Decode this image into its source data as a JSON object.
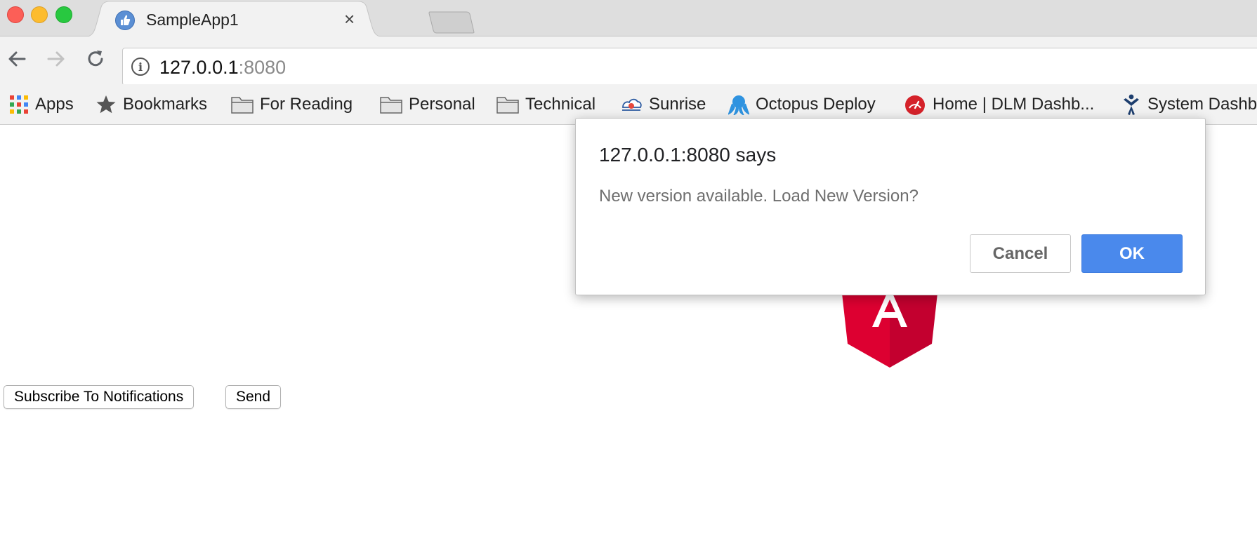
{
  "browser": {
    "tab": {
      "title": "SampleApp1",
      "close_glyph": "×"
    },
    "address": {
      "host": "127.0.0.1",
      "port": ":8080"
    },
    "nav": {
      "back": "back-arrow-icon",
      "forward": "forward-arrow-icon",
      "reload": "reload-icon"
    }
  },
  "bookmarks": [
    {
      "label": "Apps",
      "icon": "apps-grid-icon"
    },
    {
      "label": "Bookmarks",
      "icon": "star-icon"
    },
    {
      "label": "For Reading",
      "icon": "folder-icon"
    },
    {
      "label": "Personal",
      "icon": "folder-icon"
    },
    {
      "label": "Technical",
      "icon": "folder-icon"
    },
    {
      "label": "Sunrise",
      "icon": "sunrise-icon"
    },
    {
      "label": "Octopus Deploy",
      "icon": "octopus-icon"
    },
    {
      "label": "Home | DLM Dashb...",
      "icon": "dlm-dashboard-icon"
    },
    {
      "label": "System Dashb",
      "icon": "system-dashboard-icon"
    }
  ],
  "page": {
    "subscribe_label": "Subscribe To Notifications",
    "send_label": "Send",
    "logo_letter": "A"
  },
  "dialog": {
    "title": "127.0.0.1:8080 says",
    "message": "New version available. Load New Version?",
    "cancel_label": "Cancel",
    "ok_label": "OK",
    "ok_color": "#4a89ec"
  },
  "colors": {
    "angular_red_light": "#dd0031",
    "angular_red_dark": "#c3002f"
  }
}
